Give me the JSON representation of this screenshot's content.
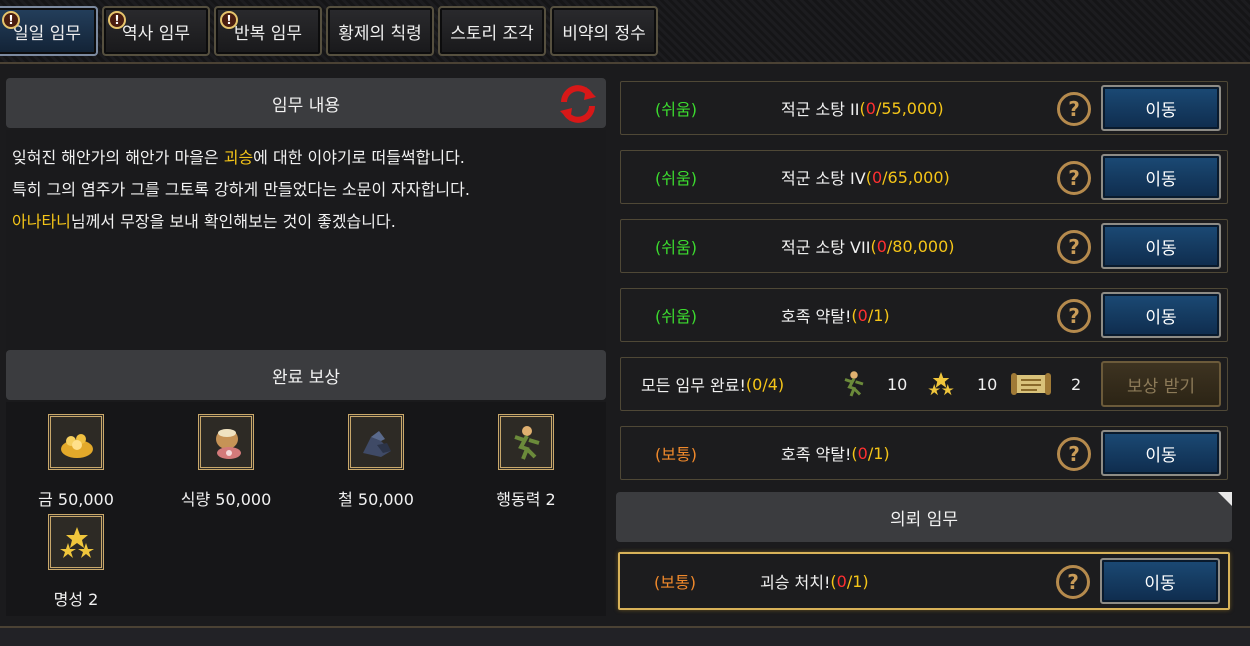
{
  "tabs": [
    {
      "label": "일일 임무",
      "alert": true,
      "active": true
    },
    {
      "label": "역사 임무",
      "alert": true,
      "active": false
    },
    {
      "label": "반복 임무",
      "alert": true,
      "active": false
    },
    {
      "label": "황제의 칙령",
      "alert": false,
      "active": false
    },
    {
      "label": "스토리 조각",
      "alert": false,
      "active": false
    },
    {
      "label": "비약의 정수",
      "alert": false,
      "active": false
    }
  ],
  "alert_symbol": "!",
  "description": {
    "header": "임무 내용",
    "line1": {
      "before": "잊혀진 해안가의 해안가 마을은 ",
      "highlight": "괴승",
      "after": "에 대한 이야기로 떠들썩합니다."
    },
    "line2": "특히 그의 염주가 그를 그토록 강하게 만들었다는 소문이 자자합니다.",
    "line3": {
      "highlight": "아나타니",
      "after": "님께서 무장을 보내 확인해보는 것이 좋겠습니다."
    }
  },
  "rewards": {
    "header": "완료 보상",
    "items": [
      {
        "icon": "gold-icon",
        "label": "금 50,000"
      },
      {
        "icon": "food-icon",
        "label": "식량 50,000"
      },
      {
        "icon": "iron-icon",
        "label": "철 50,000"
      },
      {
        "icon": "action-power-icon",
        "label": "행동력 2"
      },
      {
        "icon": "fame-icon",
        "label": "명성 2"
      }
    ]
  },
  "missions": [
    {
      "difficulty": "(쉬움)",
      "title": "적군 소탕 II ",
      "current": "0",
      "goal": "55,000",
      "button": "이동"
    },
    {
      "difficulty": "(쉬움)",
      "title": "적군 소탕 IV ",
      "current": "0",
      "goal": "65,000",
      "button": "이동"
    },
    {
      "difficulty": "(쉬움)",
      "title": "적군 소탕 VII ",
      "current": "0",
      "goal": "80,000",
      "button": "이동"
    },
    {
      "difficulty": "(쉬움)",
      "title": "호족 약탈! ",
      "current": "0",
      "goal": "1",
      "button": "이동"
    },
    {
      "difficulty": "(보통)",
      "title": "호족 약탈! ",
      "current": "0",
      "goal": "1",
      "button": "이동"
    }
  ],
  "all_complete": {
    "label": "모든 임무 완료! ",
    "progress": "(0/4)",
    "action_power": "10",
    "fame": "10",
    "scroll": "2",
    "button": "보상 받기"
  },
  "request": {
    "header": "의뢰 임무",
    "mission": {
      "difficulty": "(보통)",
      "title": "괴승 처치! ",
      "current": "0",
      "goal": "1",
      "button": "이동"
    }
  },
  "help_symbol": "?",
  "progress_format": {
    "open": "(",
    "sep": "/",
    "close": ")"
  },
  "colors": {
    "easy": "#3cdb2f",
    "normal": "#f0892b",
    "highlight": "#f5c518",
    "current": "#ff3030"
  }
}
